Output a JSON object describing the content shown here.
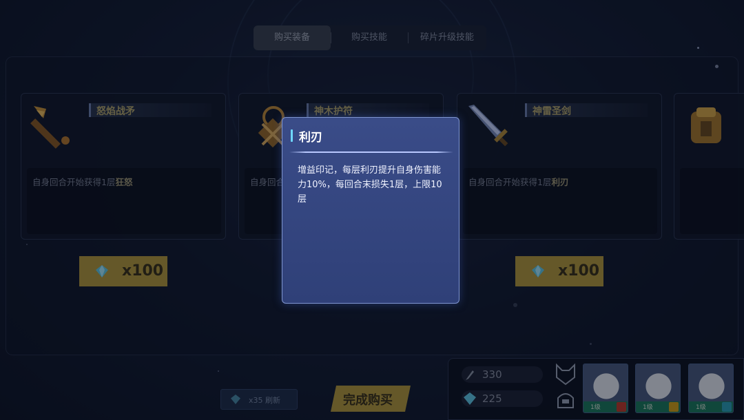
{
  "tabs": [
    {
      "label": "购买装备",
      "active": true
    },
    {
      "label": "购买技能",
      "active": false
    },
    {
      "label": "碎片升级技能",
      "active": false
    }
  ],
  "cards": [
    {
      "name": "怒焰战矛",
      "desc_prefix": "自身回合开始获得1层",
      "desc_keyword": "狂怒",
      "icon": "spear-icon",
      "price": "x100"
    },
    {
      "name": "神木护符",
      "desc_prefix": "自身回合",
      "desc_keyword": "",
      "icon": "amulet-icon"
    },
    {
      "name": "神雷圣剑",
      "desc_prefix": "自身回合开始获得1层",
      "desc_keyword": "利刃",
      "icon": "sword-icon",
      "price": "x100"
    },
    {
      "name": "",
      "desc_prefix": "",
      "desc_keyword": "",
      "icon": "armor-icon"
    }
  ],
  "popup": {
    "title": "利刃",
    "text": "增益印记，每层利刃提升自身伤害能力10%，每回合末损失1层，上限10层"
  },
  "bottom": {
    "refresh_label": "x35 刷新",
    "confirm_label": "完成购买"
  },
  "resources": [
    {
      "icon": "feather-icon",
      "value": "330"
    },
    {
      "icon": "crystal-icon",
      "value": "225"
    }
  ],
  "heroes": [
    {
      "level": "1级",
      "badge_color": "#c0392b"
    },
    {
      "level": "1级",
      "badge_color": "#d4a017"
    },
    {
      "level": "1级",
      "badge_color": "#2a9fb8"
    }
  ],
  "colors": {
    "gold": "#b59a3c",
    "popup_bg": "#34467f",
    "accent_cyan": "#6fd8ff"
  }
}
